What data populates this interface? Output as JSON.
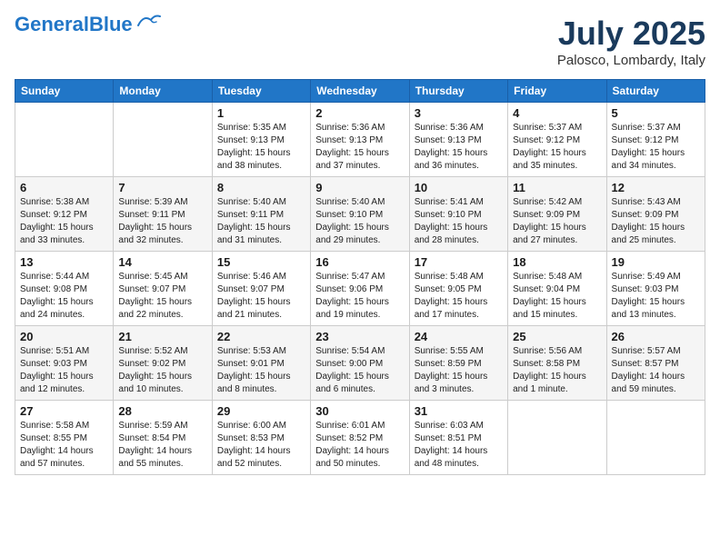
{
  "header": {
    "logo_line1": "General",
    "logo_line2": "Blue",
    "month": "July 2025",
    "location": "Palosco, Lombardy, Italy"
  },
  "weekdays": [
    "Sunday",
    "Monday",
    "Tuesday",
    "Wednesday",
    "Thursday",
    "Friday",
    "Saturday"
  ],
  "weeks": [
    [
      {
        "day": "",
        "sunrise": "",
        "sunset": "",
        "daylight": ""
      },
      {
        "day": "",
        "sunrise": "",
        "sunset": "",
        "daylight": ""
      },
      {
        "day": "1",
        "sunrise": "Sunrise: 5:35 AM",
        "sunset": "Sunset: 9:13 PM",
        "daylight": "Daylight: 15 hours and 38 minutes."
      },
      {
        "day": "2",
        "sunrise": "Sunrise: 5:36 AM",
        "sunset": "Sunset: 9:13 PM",
        "daylight": "Daylight: 15 hours and 37 minutes."
      },
      {
        "day": "3",
        "sunrise": "Sunrise: 5:36 AM",
        "sunset": "Sunset: 9:13 PM",
        "daylight": "Daylight: 15 hours and 36 minutes."
      },
      {
        "day": "4",
        "sunrise": "Sunrise: 5:37 AM",
        "sunset": "Sunset: 9:12 PM",
        "daylight": "Daylight: 15 hours and 35 minutes."
      },
      {
        "day": "5",
        "sunrise": "Sunrise: 5:37 AM",
        "sunset": "Sunset: 9:12 PM",
        "daylight": "Daylight: 15 hours and 34 minutes."
      }
    ],
    [
      {
        "day": "6",
        "sunrise": "Sunrise: 5:38 AM",
        "sunset": "Sunset: 9:12 PM",
        "daylight": "Daylight: 15 hours and 33 minutes."
      },
      {
        "day": "7",
        "sunrise": "Sunrise: 5:39 AM",
        "sunset": "Sunset: 9:11 PM",
        "daylight": "Daylight: 15 hours and 32 minutes."
      },
      {
        "day": "8",
        "sunrise": "Sunrise: 5:40 AM",
        "sunset": "Sunset: 9:11 PM",
        "daylight": "Daylight: 15 hours and 31 minutes."
      },
      {
        "day": "9",
        "sunrise": "Sunrise: 5:40 AM",
        "sunset": "Sunset: 9:10 PM",
        "daylight": "Daylight: 15 hours and 29 minutes."
      },
      {
        "day": "10",
        "sunrise": "Sunrise: 5:41 AM",
        "sunset": "Sunset: 9:10 PM",
        "daylight": "Daylight: 15 hours and 28 minutes."
      },
      {
        "day": "11",
        "sunrise": "Sunrise: 5:42 AM",
        "sunset": "Sunset: 9:09 PM",
        "daylight": "Daylight: 15 hours and 27 minutes."
      },
      {
        "day": "12",
        "sunrise": "Sunrise: 5:43 AM",
        "sunset": "Sunset: 9:09 PM",
        "daylight": "Daylight: 15 hours and 25 minutes."
      }
    ],
    [
      {
        "day": "13",
        "sunrise": "Sunrise: 5:44 AM",
        "sunset": "Sunset: 9:08 PM",
        "daylight": "Daylight: 15 hours and 24 minutes."
      },
      {
        "day": "14",
        "sunrise": "Sunrise: 5:45 AM",
        "sunset": "Sunset: 9:07 PM",
        "daylight": "Daylight: 15 hours and 22 minutes."
      },
      {
        "day": "15",
        "sunrise": "Sunrise: 5:46 AM",
        "sunset": "Sunset: 9:07 PM",
        "daylight": "Daylight: 15 hours and 21 minutes."
      },
      {
        "day": "16",
        "sunrise": "Sunrise: 5:47 AM",
        "sunset": "Sunset: 9:06 PM",
        "daylight": "Daylight: 15 hours and 19 minutes."
      },
      {
        "day": "17",
        "sunrise": "Sunrise: 5:48 AM",
        "sunset": "Sunset: 9:05 PM",
        "daylight": "Daylight: 15 hours and 17 minutes."
      },
      {
        "day": "18",
        "sunrise": "Sunrise: 5:48 AM",
        "sunset": "Sunset: 9:04 PM",
        "daylight": "Daylight: 15 hours and 15 minutes."
      },
      {
        "day": "19",
        "sunrise": "Sunrise: 5:49 AM",
        "sunset": "Sunset: 9:03 PM",
        "daylight": "Daylight: 15 hours and 13 minutes."
      }
    ],
    [
      {
        "day": "20",
        "sunrise": "Sunrise: 5:51 AM",
        "sunset": "Sunset: 9:03 PM",
        "daylight": "Daylight: 15 hours and 12 minutes."
      },
      {
        "day": "21",
        "sunrise": "Sunrise: 5:52 AM",
        "sunset": "Sunset: 9:02 PM",
        "daylight": "Daylight: 15 hours and 10 minutes."
      },
      {
        "day": "22",
        "sunrise": "Sunrise: 5:53 AM",
        "sunset": "Sunset: 9:01 PM",
        "daylight": "Daylight: 15 hours and 8 minutes."
      },
      {
        "day": "23",
        "sunrise": "Sunrise: 5:54 AM",
        "sunset": "Sunset: 9:00 PM",
        "daylight": "Daylight: 15 hours and 6 minutes."
      },
      {
        "day": "24",
        "sunrise": "Sunrise: 5:55 AM",
        "sunset": "Sunset: 8:59 PM",
        "daylight": "Daylight: 15 hours and 3 minutes."
      },
      {
        "day": "25",
        "sunrise": "Sunrise: 5:56 AM",
        "sunset": "Sunset: 8:58 PM",
        "daylight": "Daylight: 15 hours and 1 minute."
      },
      {
        "day": "26",
        "sunrise": "Sunrise: 5:57 AM",
        "sunset": "Sunset: 8:57 PM",
        "daylight": "Daylight: 14 hours and 59 minutes."
      }
    ],
    [
      {
        "day": "27",
        "sunrise": "Sunrise: 5:58 AM",
        "sunset": "Sunset: 8:55 PM",
        "daylight": "Daylight: 14 hours and 57 minutes."
      },
      {
        "day": "28",
        "sunrise": "Sunrise: 5:59 AM",
        "sunset": "Sunset: 8:54 PM",
        "daylight": "Daylight: 14 hours and 55 minutes."
      },
      {
        "day": "29",
        "sunrise": "Sunrise: 6:00 AM",
        "sunset": "Sunset: 8:53 PM",
        "daylight": "Daylight: 14 hours and 52 minutes."
      },
      {
        "day": "30",
        "sunrise": "Sunrise: 6:01 AM",
        "sunset": "Sunset: 8:52 PM",
        "daylight": "Daylight: 14 hours and 50 minutes."
      },
      {
        "day": "31",
        "sunrise": "Sunrise: 6:03 AM",
        "sunset": "Sunset: 8:51 PM",
        "daylight": "Daylight: 14 hours and 48 minutes."
      },
      {
        "day": "",
        "sunrise": "",
        "sunset": "",
        "daylight": ""
      },
      {
        "day": "",
        "sunrise": "",
        "sunset": "",
        "daylight": ""
      }
    ]
  ]
}
